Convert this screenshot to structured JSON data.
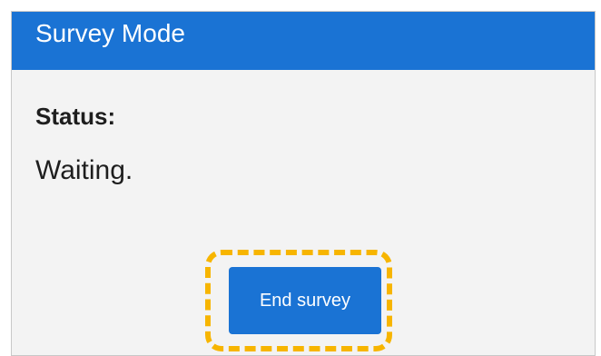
{
  "header": {
    "title": "Survey Mode"
  },
  "status": {
    "label": "Status:",
    "value": "Waiting."
  },
  "actions": {
    "end_survey_label": "End survey"
  },
  "colors": {
    "primary": "#1a73d4",
    "panel_background": "#f3f3f3",
    "highlight": "#f7b500",
    "text": "#1e1e1e"
  }
}
